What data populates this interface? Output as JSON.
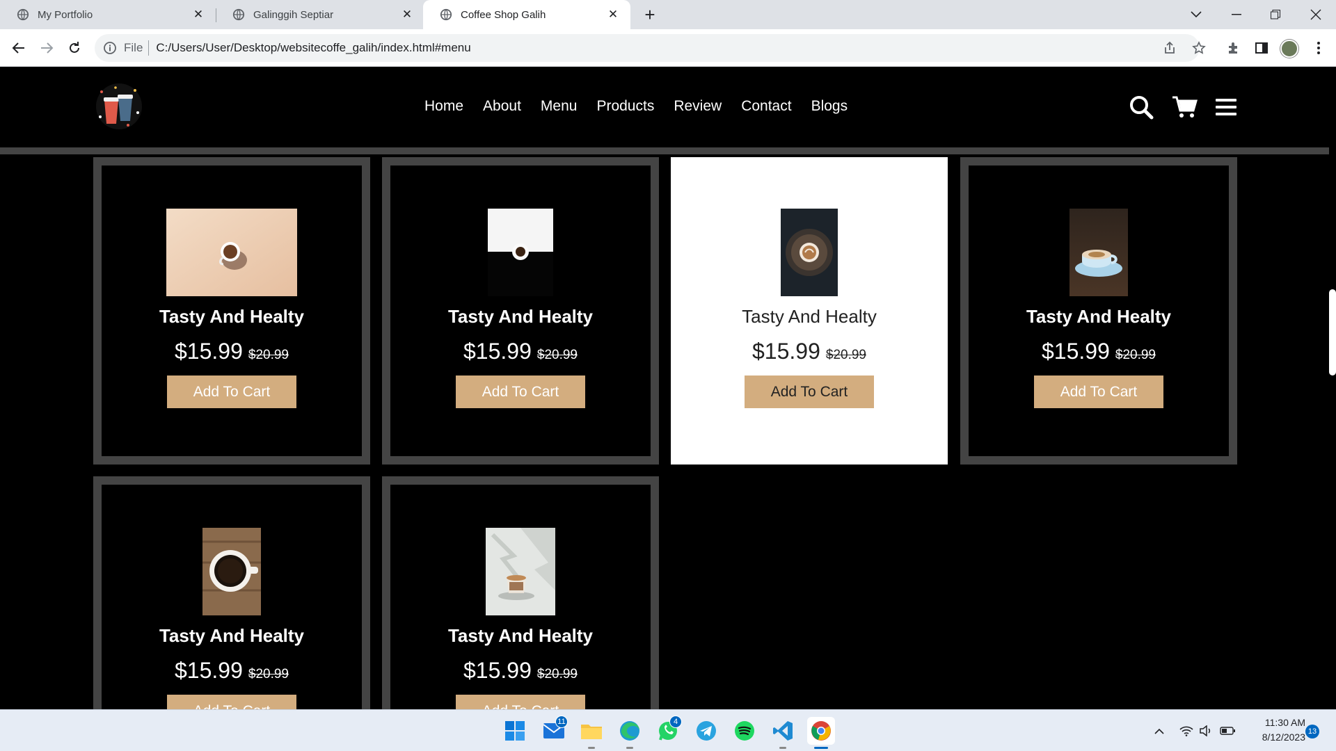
{
  "browser": {
    "tabs": [
      {
        "label": "My Portfolio",
        "active": false
      },
      {
        "label": "Galinggih Septiar",
        "active": false
      },
      {
        "label": "Coffee Shop Galih",
        "active": true
      }
    ],
    "address": {
      "scheme": "File",
      "url": "C:/Users/User/Desktop/websitecoffe_galih/index.html#menu"
    }
  },
  "site": {
    "nav": [
      "Home",
      "About",
      "Menu",
      "Products",
      "Review",
      "Contact",
      "Blogs"
    ],
    "products": [
      {
        "title": "Tasty And Healty",
        "price": "$15.99",
        "old_price": "$20.99",
        "button": "Add To Cart",
        "photo": "coffee-cup-beige"
      },
      {
        "title": "Tasty And Healty",
        "price": "$15.99",
        "old_price": "$20.99",
        "button": "Add To Cart",
        "photo": "coffee-cup-white-black"
      },
      {
        "title": "Tasty And Healty",
        "price": "$15.99",
        "old_price": "$20.99",
        "button": "Add To Cart",
        "photo": "latte-art-dark"
      },
      {
        "title": "Tasty And Healty",
        "price": "$15.99",
        "old_price": "$20.99",
        "button": "Add To Cart",
        "photo": "cup-on-saucer"
      },
      {
        "title": "Tasty And Healty",
        "price": "$15.99",
        "old_price": "$20.99",
        "button": "Add To Cart",
        "photo": "black-coffee-wood"
      },
      {
        "title": "Tasty And Healty",
        "price": "$15.99",
        "old_price": "$20.99",
        "button": "Add To Cart",
        "photo": "espresso-shadow"
      }
    ],
    "colors": {
      "accent": "#d3ad7f",
      "border": "#444444",
      "background": "#000000"
    }
  },
  "taskbar": {
    "badges": {
      "mail": "11",
      "whatsapp": "4"
    },
    "time": "11:30 AM",
    "date": "8/12/2023",
    "notifications": "13"
  }
}
